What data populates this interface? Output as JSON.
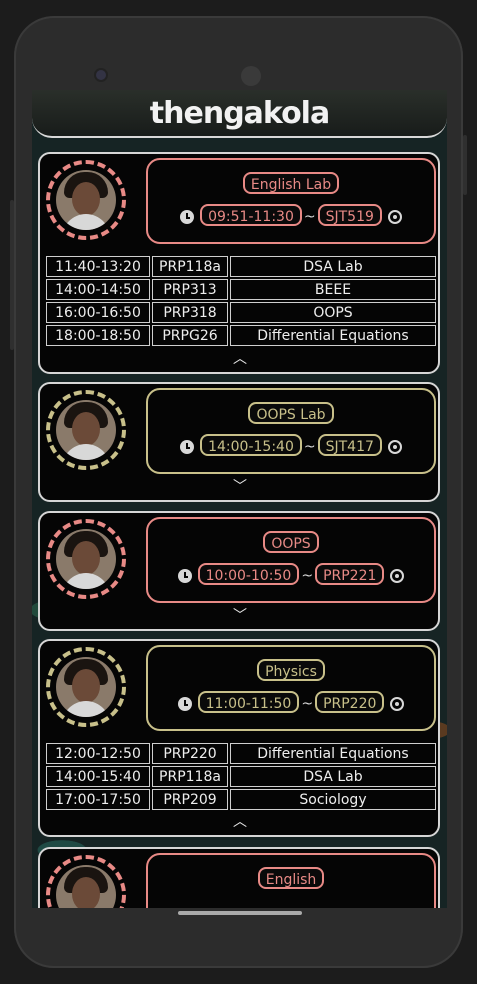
{
  "app": {
    "title": "thengakola"
  },
  "colors": {
    "pink": "#e88a86",
    "khaki": "#c8c08a",
    "line": "#d6d6d6"
  },
  "cards": [
    {
      "accent": "#e88a86",
      "subject": "English Lab",
      "time": "09:51-11:30",
      "room": "SJT519",
      "expanded": true,
      "schedule": [
        [
          "11:40-13:20",
          "PRP118a",
          "DSA Lab"
        ],
        [
          "14:00-14:50",
          "PRP313",
          "BEEE"
        ],
        [
          "16:00-16:50",
          "PRP318",
          "OOPS"
        ],
        [
          "18:00-18:50",
          "PRPG26",
          "Differential Equations"
        ]
      ]
    },
    {
      "accent": "#c8c08a",
      "subject": "OOPS Lab",
      "time": "14:00-15:40",
      "room": "SJT417",
      "expanded": false
    },
    {
      "accent": "#e88a86",
      "subject": "OOPS",
      "time": "10:00-10:50",
      "room": "PRP221",
      "expanded": false
    },
    {
      "accent": "#c8c08a",
      "subject": "Physics",
      "time": "11:00-11:50",
      "room": "PRP220",
      "expanded": true,
      "schedule": [
        [
          "12:00-12:50",
          "PRP220",
          "Differential Equations"
        ],
        [
          "14:00-15:40",
          "PRP118a",
          "DSA Lab"
        ],
        [
          "17:00-17:50",
          "PRP209",
          "Sociology"
        ]
      ]
    },
    {
      "accent": "#e88a86",
      "subject": "English",
      "time": "",
      "room": "",
      "expanded": false
    }
  ],
  "icons": {
    "clock": "clock-icon",
    "location": "location-target-icon",
    "chevron_up": "chevron-up-icon",
    "chevron_down": "chevron-down-icon"
  }
}
